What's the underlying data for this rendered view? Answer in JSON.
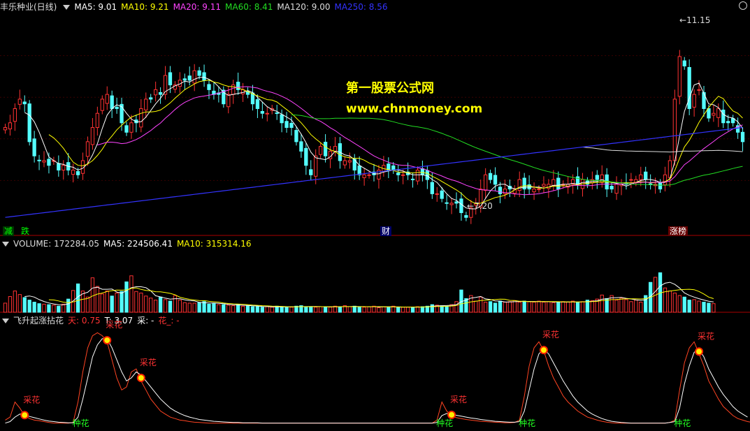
{
  "price_panel": {
    "title": "丰乐种业(日线)",
    "ma": [
      {
        "label": "MA5: 9.01",
        "color": "#ffffff"
      },
      {
        "label": "MA10: 9.21",
        "color": "#ffff00"
      },
      {
        "label": "MA20: 9.11",
        "color": "#ff44ff"
      },
      {
        "label": "MA60: 8.41",
        "color": "#22dd22"
      },
      {
        "label": "MA120: 9.00",
        "color": "#dddddd"
      },
      {
        "label": "MA250: 8.56",
        "color": "#3333ff"
      }
    ],
    "high_label": "11.15",
    "low_label": "7.20",
    "watermark_title": "第一股票公式网",
    "watermark_url": "www.chnmoney.com",
    "events": [
      {
        "text": "减",
        "color": "#00ff00",
        "bg": "#003300"
      },
      {
        "text": "跌",
        "color": "#00ff00",
        "bg": "#000000"
      },
      {
        "text": "财",
        "color": "#ffffff",
        "bg": "#000066"
      },
      {
        "text": "涨榜",
        "color": "#ffffff",
        "bg": "#660000"
      }
    ]
  },
  "volume_panel": {
    "label": "VOLUME: 172284.05",
    "ma5": "MA5: 224506.41",
    "ma10": "MA10: 315314.16"
  },
  "indicator_panel": {
    "name": "飞升起涨拈花",
    "tian": "天: 0.75",
    "t": "T: 3.07",
    "cai": "采: -",
    "hua": "花_: -",
    "cai_label": "采花",
    "zhong_label": "种花"
  },
  "chart_data": {
    "type": "candlestick",
    "ylim": [
      6.9,
      11.3
    ],
    "closes": [
      8.9,
      9.0,
      9.3,
      9.5,
      9.4,
      8.6,
      8.3,
      8.2,
      8.2,
      8.1,
      8.2,
      8.0,
      8.1,
      8.0,
      8.0,
      7.9,
      8.2,
      8.6,
      8.9,
      9.2,
      9.5,
      9.6,
      9.3,
      9.3,
      9.0,
      8.8,
      9.0,
      9.0,
      9.3,
      9.5,
      9.5,
      9.7,
      9.6,
      10.0,
      9.8,
      9.8,
      9.9,
      9.9,
      9.9,
      10.1,
      10.0,
      9.9,
      9.7,
      9.6,
      9.6,
      9.4,
      9.6,
      9.8,
      9.7,
      9.7,
      9.6,
      9.4,
      9.3,
      9.2,
      9.2,
      9.3,
      9.2,
      9.0,
      8.9,
      8.9,
      8.6,
      8.4,
      8.1,
      7.9,
      8.3,
      8.5,
      8.3,
      8.4,
      8.5,
      8.2,
      8.2,
      8.2,
      8.0,
      7.9,
      7.9,
      7.9,
      7.9,
      8.0,
      8.1,
      8.0,
      8.0,
      7.9,
      7.9,
      7.9,
      7.8,
      8.0,
      7.9,
      7.8,
      7.5,
      7.5,
      7.4,
      7.3,
      7.3,
      7.3,
      7.1,
      7.0,
      7.2,
      7.3,
      7.6,
      7.9,
      7.8,
      7.7,
      7.5,
      7.6,
      7.6,
      7.6,
      7.8,
      7.6,
      7.6,
      7.6,
      7.6,
      7.7,
      7.7,
      7.8,
      7.6,
      7.7,
      7.7,
      7.8,
      7.7,
      7.8,
      7.7,
      7.8,
      7.8,
      7.9,
      7.6,
      7.6,
      7.7,
      7.7,
      7.7,
      7.8,
      7.8,
      7.9,
      7.8,
      7.7,
      7.7,
      7.6,
      7.9,
      8.2,
      9.5,
      10.4,
      10.2,
      9.3,
      9.6,
      9.7,
      9.3,
      9.1,
      9.2,
      9.3,
      9.0,
      9.0,
      9.0,
      8.8,
      8.6
    ],
    "volume_ylim": [
      0,
      1200000
    ],
    "volumes": [
      180000,
      310000,
      420000,
      350000,
      290000,
      240000,
      200000,
      170000,
      160000,
      150000,
      140000,
      120000,
      160000,
      260000,
      430000,
      560000,
      420000,
      300000,
      680000,
      510000,
      360000,
      420000,
      320000,
      380000,
      410000,
      600000,
      720000,
      410000,
      380000,
      320000,
      280000,
      240000,
      300000,
      250000,
      220000,
      330000,
      240000,
      190000,
      180000,
      180000,
      190000,
      210000,
      160000,
      170000,
      150000,
      150000,
      140000,
      130000,
      150000,
      120000,
      130000,
      110000,
      110000,
      100000,
      110000,
      100000,
      120000,
      110000,
      100000,
      100000,
      120000,
      130000,
      110000,
      110000,
      100000,
      110000,
      110000,
      100000,
      120000,
      100000,
      130000,
      110000,
      120000,
      100000,
      100000,
      110000,
      120000,
      90000,
      110000,
      100000,
      120000,
      90000,
      100000,
      100000,
      100000,
      110000,
      110000,
      120000,
      150000,
      140000,
      130000,
      120000,
      150000,
      210000,
      440000,
      270000,
      330000,
      220000,
      300000,
      200000,
      210000,
      180000,
      220000,
      200000,
      210000,
      230000,
      200000,
      220000,
      210000,
      200000,
      220000,
      200000,
      210000,
      190000,
      200000,
      210000,
      200000,
      220000,
      190000,
      210000,
      240000,
      230000,
      260000,
      340000,
      270000,
      330000,
      240000,
      280000,
      250000,
      210000,
      240000,
      200000,
      330000,
      590000,
      690000,
      780000,
      480000,
      420000,
      380000,
      330000,
      300000,
      240000,
      250000,
      220000,
      200000,
      180000,
      170000
    ],
    "indicator_ylim": [
      0,
      3.2
    ],
    "ind_red": [
      0.2,
      0.3,
      0.8,
      0.6,
      0.35,
      0.25,
      0.2,
      0.18,
      0.15,
      0.12,
      0.1,
      0.1,
      0.1,
      0.1,
      0.12,
      0.8,
      1.8,
      2.6,
      3.0,
      3.1,
      3.0,
      2.8,
      2.2,
      1.6,
      1.2,
      1.3,
      1.8,
      1.9,
      1.5,
      1.2,
      0.9,
      0.7,
      0.5,
      0.4,
      0.3,
      0.25,
      0.2,
      0.18,
      0.15,
      0.13,
      0.12,
      0.11,
      0.1,
      0.1,
      0.1,
      0.1,
      0.1,
      0.1,
      0.1,
      0.1,
      0.1,
      0.1,
      0.1,
      0.1,
      0.1,
      0.1,
      0.1,
      0.1,
      0.1,
      0.1,
      0.1,
      0.1,
      0.1,
      0.1,
      0.1,
      0.1,
      0.1,
      0.1,
      0.1,
      0.1,
      0.1,
      0.1,
      0.1,
      0.1,
      0.1,
      0.1,
      0.1,
      0.1,
      0.1,
      0.1,
      0.1,
      0.1,
      0.1,
      0.1,
      0.1,
      0.1,
      0.1,
      0.1,
      0.1,
      0.2,
      0.8,
      0.5,
      0.35,
      0.28,
      0.25,
      0.22,
      0.2,
      0.18,
      0.16,
      0.15,
      0.14,
      0.13,
      0.12,
      0.11,
      0.11,
      0.12,
      0.2,
      1.0,
      2.0,
      2.6,
      2.8,
      2.5,
      2.0,
      1.6,
      1.3,
      1.0,
      0.8,
      0.65,
      0.5,
      0.4,
      0.3,
      0.25,
      0.2,
      0.16,
      0.13,
      0.11,
      0.1,
      0.1,
      0.1,
      0.1,
      0.1,
      0.1,
      0.1,
      0.1,
      0.1,
      0.1,
      0.1,
      0.12,
      0.2,
      1.2,
      2.1,
      2.6,
      2.8,
      2.4,
      2.0,
      1.5,
      1.2,
      0.9,
      0.65,
      0.5,
      0.35,
      0.25,
      0.2,
      0.15,
      0.12
    ],
    "ind_white": [
      0.1,
      0.15,
      0.3,
      0.4,
      0.38,
      0.32,
      0.28,
      0.24,
      0.2,
      0.17,
      0.15,
      0.13,
      0.12,
      0.11,
      0.11,
      0.3,
      0.9,
      1.6,
      2.3,
      2.7,
      2.9,
      2.9,
      2.6,
      2.2,
      1.8,
      1.5,
      1.6,
      1.8,
      1.7,
      1.5,
      1.3,
      1.1,
      0.9,
      0.75,
      0.6,
      0.5,
      0.42,
      0.35,
      0.3,
      0.26,
      0.22,
      0.2,
      0.18,
      0.16,
      0.15,
      0.14,
      0.13,
      0.12,
      0.12,
      0.11,
      0.11,
      0.11,
      0.11,
      0.1,
      0.1,
      0.1,
      0.1,
      0.1,
      0.1,
      0.1,
      0.1,
      0.1,
      0.1,
      0.1,
      0.1,
      0.1,
      0.1,
      0.1,
      0.1,
      0.1,
      0.1,
      0.1,
      0.1,
      0.1,
      0.1,
      0.1,
      0.1,
      0.1,
      0.1,
      0.1,
      0.1,
      0.1,
      0.1,
      0.1,
      0.1,
      0.1,
      0.1,
      0.1,
      0.1,
      0.12,
      0.35,
      0.42,
      0.4,
      0.36,
      0.33,
      0.3,
      0.27,
      0.25,
      0.22,
      0.2,
      0.18,
      0.16,
      0.15,
      0.14,
      0.13,
      0.13,
      0.15,
      0.5,
      1.2,
      1.9,
      2.4,
      2.55,
      2.4,
      2.1,
      1.8,
      1.5,
      1.25,
      1.0,
      0.8,
      0.65,
      0.5,
      0.4,
      0.32,
      0.25,
      0.2,
      0.16,
      0.14,
      0.12,
      0.11,
      0.1,
      0.1,
      0.1,
      0.1,
      0.1,
      0.1,
      0.1,
      0.1,
      0.12,
      0.15,
      0.6,
      1.4,
      2.0,
      2.45,
      2.55,
      2.3,
      1.9,
      1.6,
      1.3,
      1.05,
      0.85,
      0.65,
      0.5,
      0.4,
      0.3
    ]
  }
}
